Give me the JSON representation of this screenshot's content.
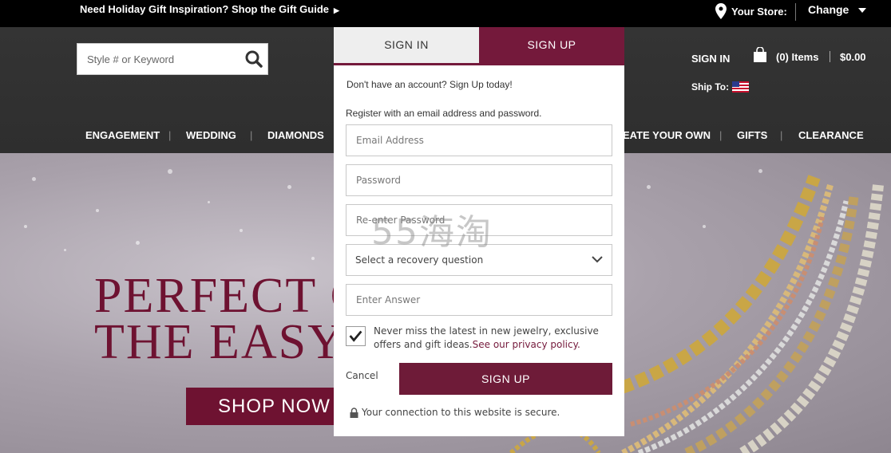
{
  "topbar": {
    "promo": "Need Holiday Gift Inspiration? Shop the Gift Guide",
    "store_label": "Your Store:",
    "change": "Change"
  },
  "header": {
    "search_placeholder": "Style # or Keyword",
    "sign_in": "SIGN IN",
    "items": "(0) Items",
    "total": "$0.00",
    "ship_to": "Ship To:"
  },
  "nav": {
    "items": [
      "ENGAGEMENT",
      "WEDDING",
      "DIAMONDS",
      "EATE YOUR OWN",
      "GIFTS",
      "CLEARANCE"
    ]
  },
  "hero": {
    "title_line1": "PERFECT C",
    "title_line2": "THE EASY",
    "button": "SHOP NOW"
  },
  "modal": {
    "tab_signin": "SIGN IN",
    "tab_signup": "SIGN UP",
    "intro": "Don't have an account? Sign Up today!",
    "instruction": "Register with an email address and password.",
    "email_placeholder": "Email Address",
    "password_placeholder": "Password",
    "reenter_placeholder": "Re-enter Password",
    "recovery_select": "Select a recovery question",
    "answer_placeholder": "Enter Answer",
    "optin_text": "Never miss the latest in new jewelry, exclusive offers and gift ideas.",
    "optin_link": "See our privacy policy.",
    "optin_checked": true,
    "cancel": "Cancel",
    "submit": "SIGN UP",
    "secure": "Your connection to this website is secure."
  },
  "watermark": "55海淘",
  "colors": {
    "brand": "#74193b",
    "topbar": "#000000",
    "header": "#333333"
  }
}
